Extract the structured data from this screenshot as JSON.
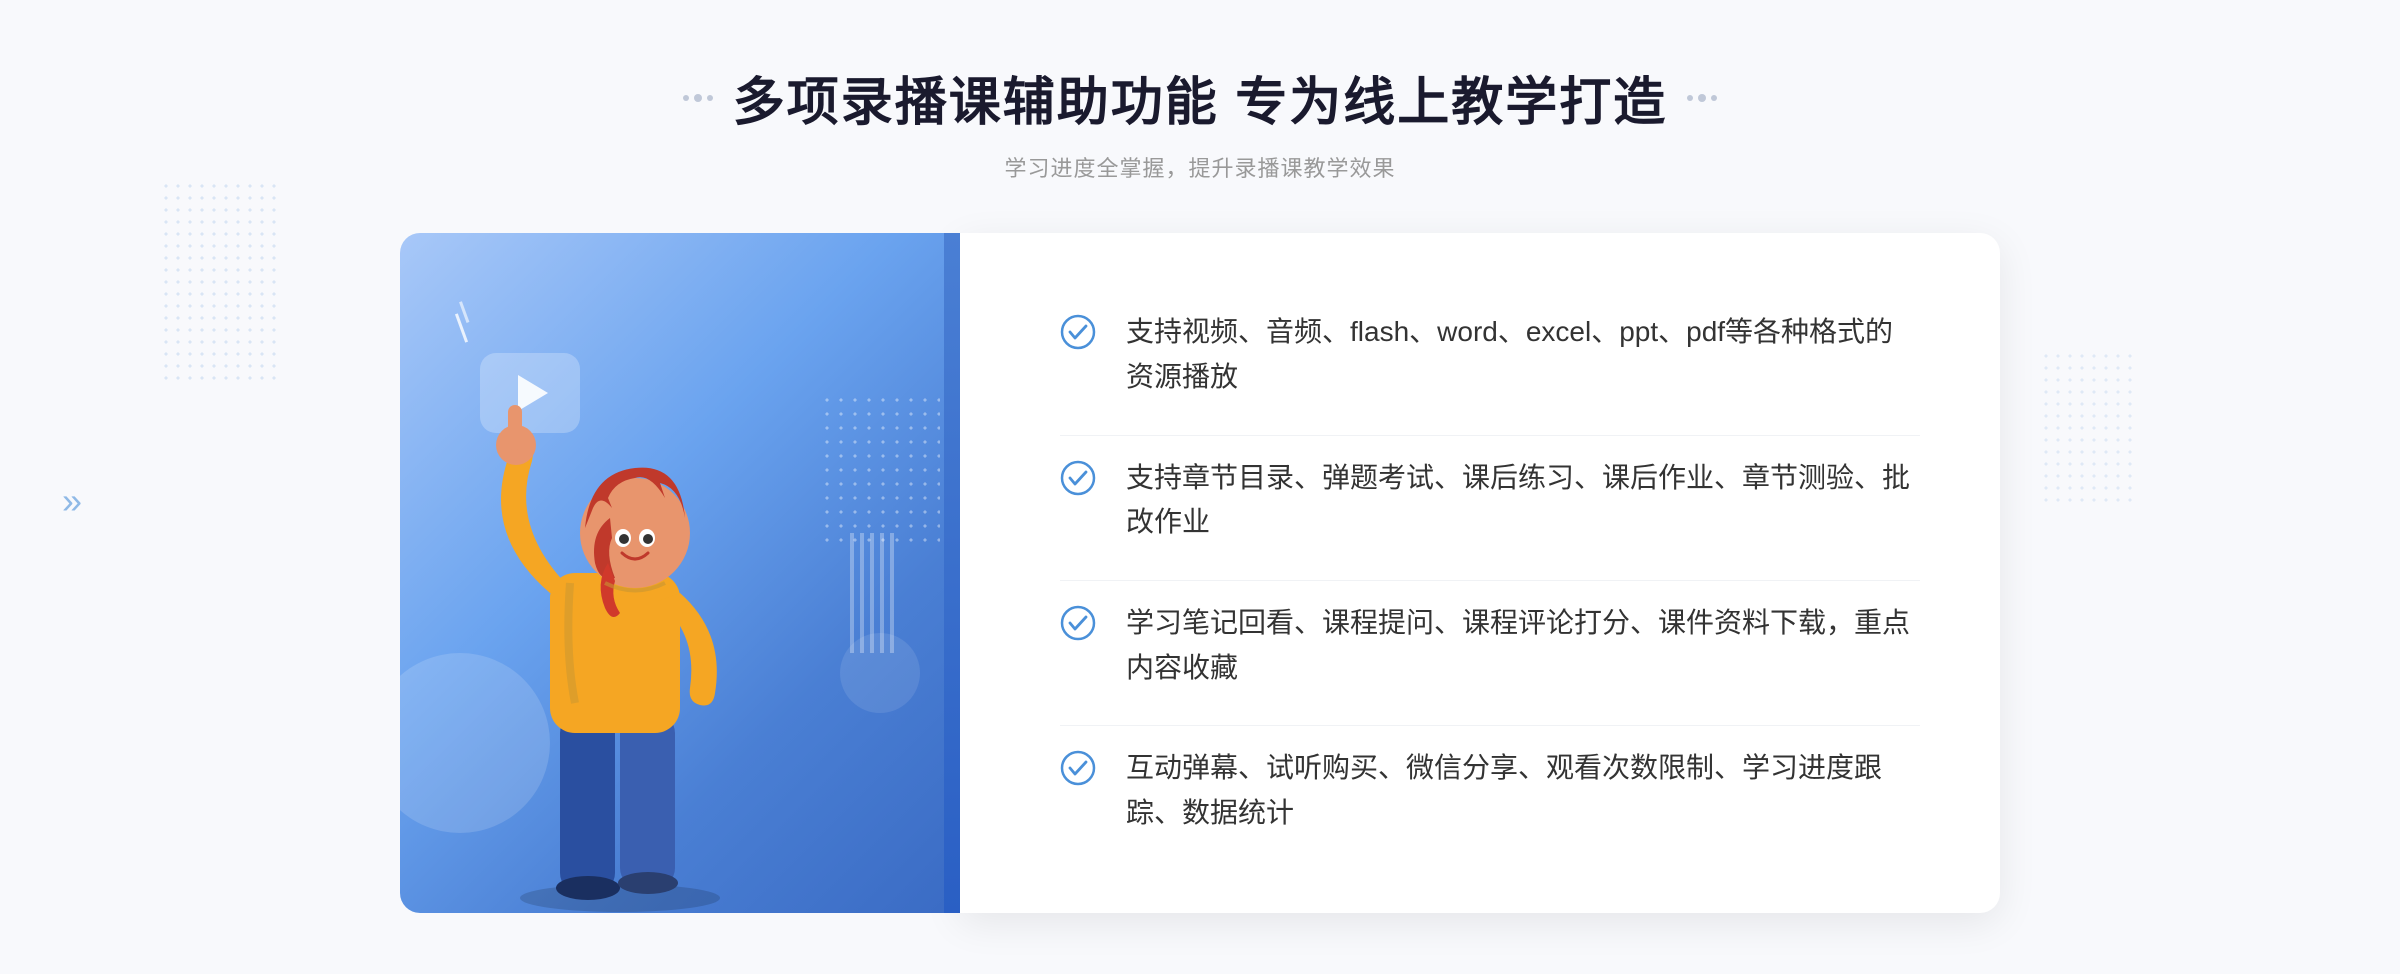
{
  "page": {
    "background": "#f8f9fc"
  },
  "header": {
    "title": "多项录播课辅助功能 专为线上教学打造",
    "subtitle": "学习进度全掌握，提升录播课教学效果"
  },
  "features": [
    {
      "id": 1,
      "text": "支持视频、音频、flash、word、excel、ppt、pdf等各种格式的资源播放"
    },
    {
      "id": 2,
      "text": "支持章节目录、弹题考试、课后练习、课后作业、章节测验、批改作业"
    },
    {
      "id": 3,
      "text": "学习笔记回看、课程提问、课程评论打分、课件资料下载，重点内容收藏"
    },
    {
      "id": 4,
      "text": "互动弹幕、试听购买、微信分享、观看次数限制、学习进度跟踪、数据统计"
    }
  ],
  "decorations": {
    "dots_left": "·· ·",
    "dots_right": "·· ·",
    "arrow_left": "»"
  }
}
